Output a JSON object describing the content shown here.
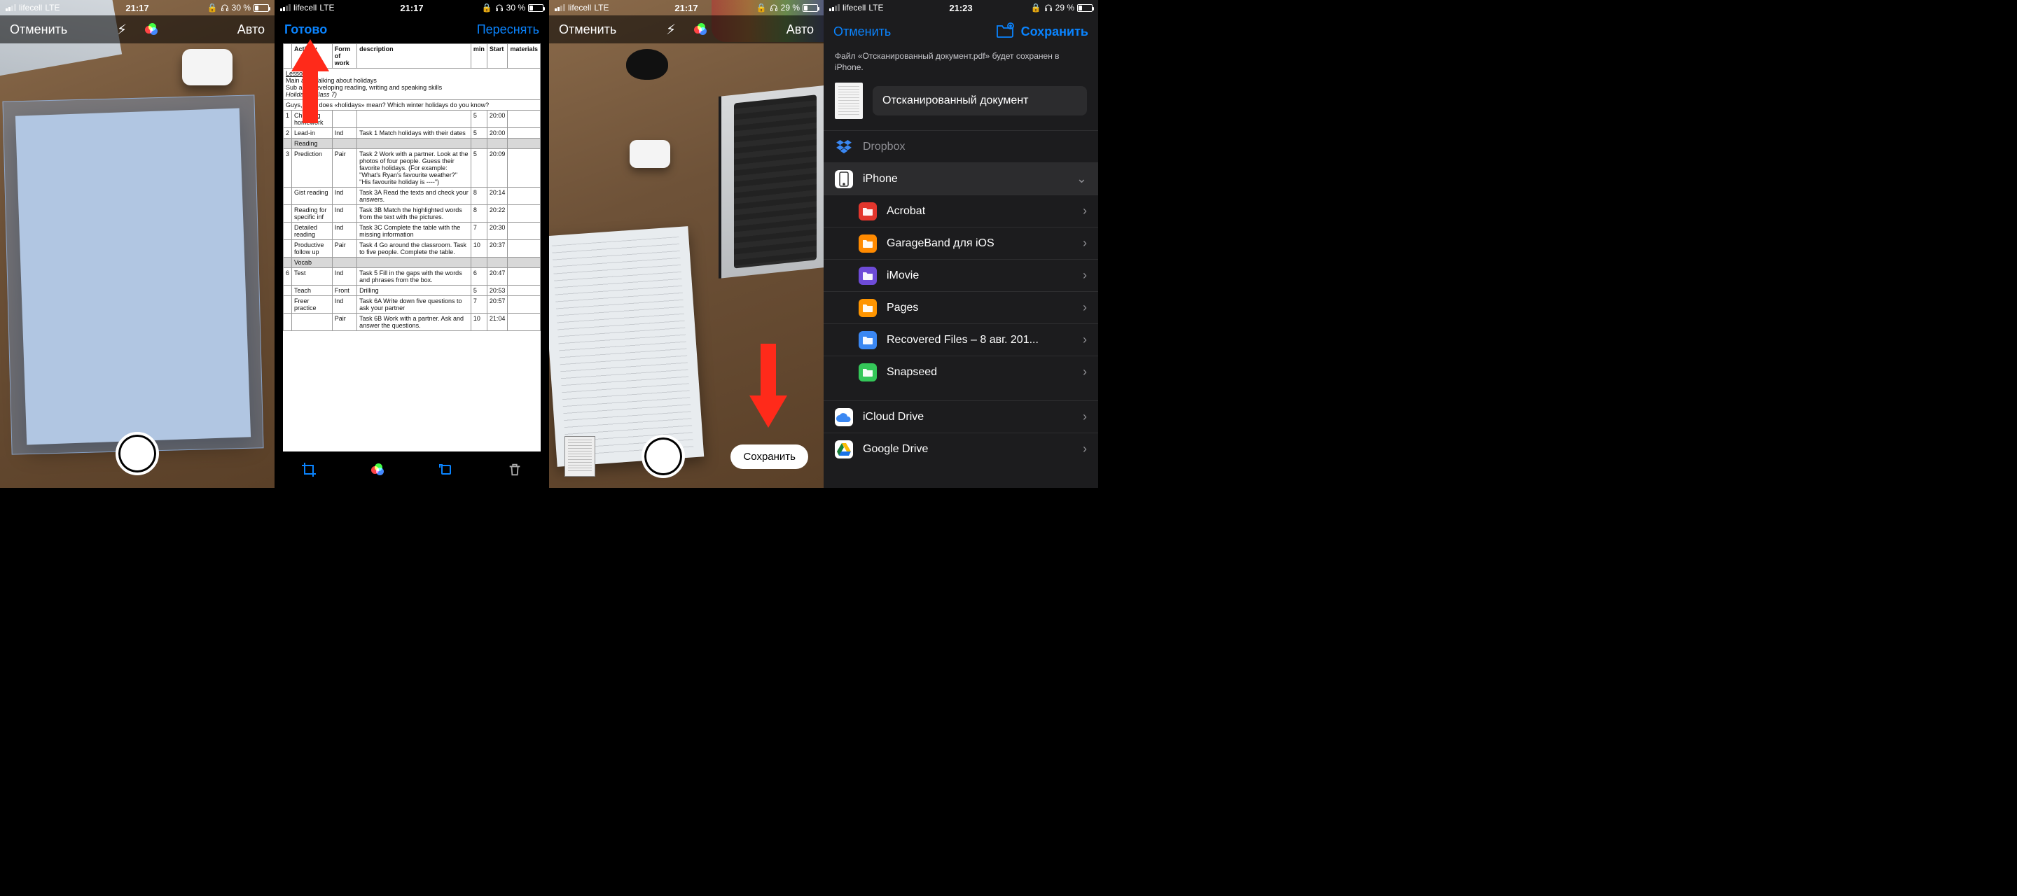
{
  "colors": {
    "accent": "#0a84ff",
    "arrow": "#ff2a1a"
  },
  "status": {
    "carrier": "lifecell",
    "network": "LTE",
    "battery1": "30 %",
    "battery2": "29 %",
    "time1": "21:17",
    "time2": "21:23",
    "locked": "🔒"
  },
  "s1": {
    "cancel": "Отменить",
    "auto": "Авто"
  },
  "s2": {
    "done": "Готово",
    "retake": "Переснять",
    "doc": {
      "headers": [
        "",
        "Activity",
        "Form of work",
        "description",
        "min",
        "Start",
        "materials"
      ],
      "title_line1": "Lesson 11",
      "title_line2": "Main aim: Talking about holidays",
      "title_line3": "Sub aim: developing reading, writing and speaking skills",
      "title_line4": "Holidays (Class 7)",
      "prompt": "Guys, what does «holidays» mean? Which winter holidays do you know?",
      "rows": [
        {
          "n": "1",
          "act": "Checking homework",
          "form": "",
          "desc": "",
          "min": "5",
          "start": "20:00"
        },
        {
          "n": "2",
          "act": "Lead-in",
          "form": "Ind",
          "desc": "Task 1 Match holidays with their dates",
          "min": "5",
          "start": "20:00"
        },
        {
          "n": "",
          "act": "Reading",
          "form": "",
          "desc": "",
          "min": "",
          "start": "",
          "shaded": true
        },
        {
          "n": "3",
          "act": "Prediction",
          "form": "Pair",
          "desc": "Task 2 Work with a partner. Look at the photos of four people. Guess their favorite holidays. (For example: \"What's Ryan's favourite weather?\" \"His favourite holiday is ----\")",
          "min": "5",
          "start": "20:09"
        },
        {
          "n": "",
          "act": "Gist reading",
          "form": "Ind",
          "desc": "Task 3A Read the texts and check your answers.",
          "min": "8",
          "start": "20:14"
        },
        {
          "n": "",
          "act": "Reading for specific inf",
          "form": "Ind",
          "desc": "Task 3B Match the highlighted words from the text with the pictures.",
          "min": "8",
          "start": "20:22"
        },
        {
          "n": "",
          "act": "Detailed reading",
          "form": "Ind",
          "desc": "Task 3C Complete the table with the missing information",
          "min": "7",
          "start": "20:30"
        },
        {
          "n": "",
          "act": "Productive follow up",
          "form": "Pair",
          "desc": "Task 4 Go around the classroom. Task to five people. Complete the table.",
          "min": "10",
          "start": "20:37"
        },
        {
          "n": "",
          "act": "Vocab",
          "form": "",
          "desc": "",
          "min": "",
          "start": "",
          "shaded": true
        },
        {
          "n": "6",
          "act": "Test",
          "form": "Ind",
          "desc": "Task 5 Fill in the gaps with the words and phrases from the box.",
          "min": "6",
          "start": "20:47"
        },
        {
          "n": "",
          "act": "Teach",
          "form": "Front",
          "desc": "Drilling",
          "min": "5",
          "start": "20:53"
        },
        {
          "n": "",
          "act": "Freer practice",
          "form": "Ind",
          "desc": "Task 6A Write down five questions to ask your partner",
          "min": "7",
          "start": "20:57"
        },
        {
          "n": "",
          "act": "",
          "form": "Pair",
          "desc": "Task 6B Work with a partner. Ask and answer the questions.",
          "min": "10",
          "start": "21:04"
        }
      ]
    }
  },
  "s3": {
    "cancel": "Отменить",
    "auto": "Авто",
    "save": "Сохранить"
  },
  "s4": {
    "cancel": "Отменить",
    "save": "Сохранить",
    "message": "Файл «Отсканированный документ.pdf» будет сохранен в iPhone.",
    "filename": "Отсканированный документ",
    "locations": {
      "dropbox": "Dropbox",
      "iphone": "iPhone",
      "children": [
        {
          "label": "Acrobat",
          "icon": "bg-red"
        },
        {
          "label": "GarageBand для iOS",
          "icon": "bg-orange"
        },
        {
          "label": "iMovie",
          "icon": "bg-purple"
        },
        {
          "label": "Pages",
          "icon": "bg-orange2"
        },
        {
          "label": "Recovered Files – 8 авг. 201...",
          "icon": "bg-blue"
        },
        {
          "label": "Snapseed",
          "icon": "bg-green"
        }
      ],
      "icloud": "iCloud Drive",
      "gdrive": "Google Drive"
    }
  }
}
